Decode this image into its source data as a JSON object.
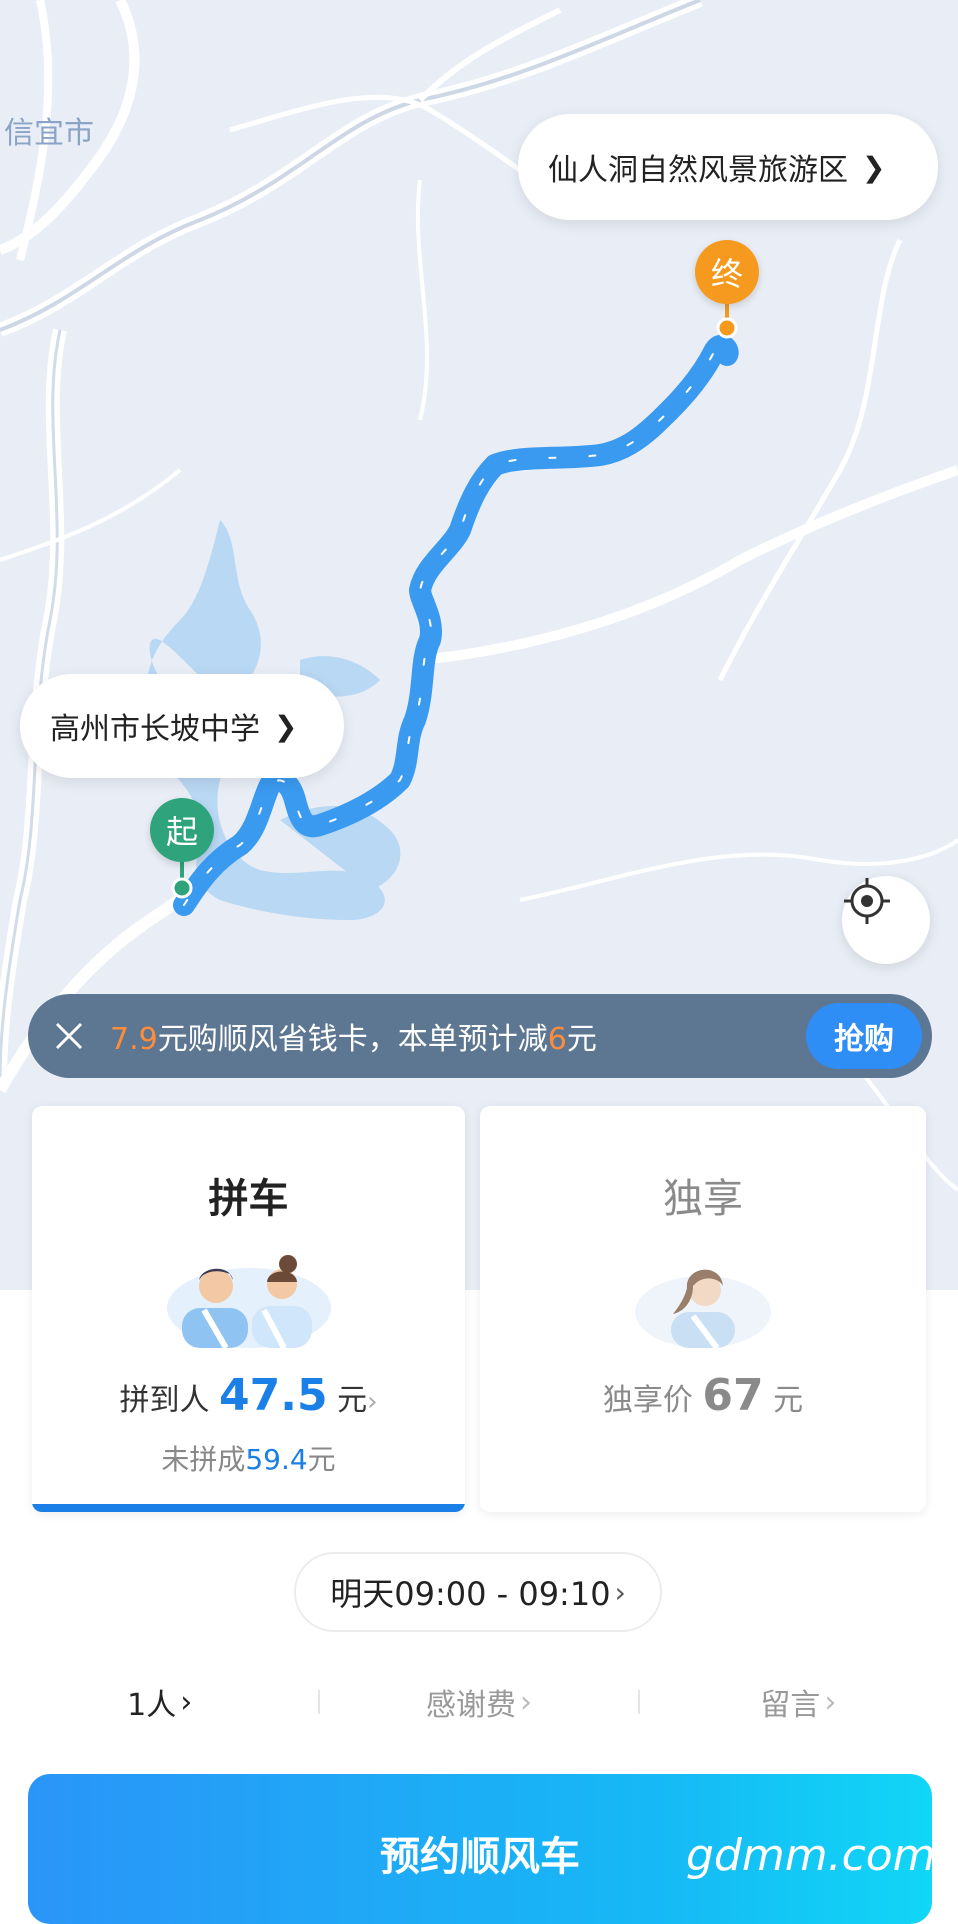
{
  "map": {
    "city_label": "信宜市",
    "destination_label": "仙人洞自然风景旅游区",
    "origin_label": "高州市长坡中学",
    "start_pin": "起",
    "end_pin": "终",
    "locate_icon": "locate-target-icon",
    "colors": {
      "route": "#3a9af0",
      "start": "#2fa37b",
      "end": "#f59a1e"
    }
  },
  "promo": {
    "price": "7.9",
    "text_a": "元购顺风省钱卡，本单预计减",
    "discount": "6",
    "text_b": "元",
    "button": "抢购",
    "close_icon": "close-icon"
  },
  "cards": {
    "carpool": {
      "title": "拼车",
      "price_prefix": "拼到人",
      "price": "47.5",
      "unit": "元",
      "sub_prefix": "未拼成",
      "sub_price": "59.4",
      "sub_unit": "元"
    },
    "exclusive": {
      "title": "独享",
      "price_prefix": "独享价",
      "price": "67",
      "unit": "元"
    }
  },
  "time": {
    "label": "明天09:00 - 09:10"
  },
  "options": [
    {
      "label": "1人"
    },
    {
      "label": "感谢费"
    },
    {
      "label": "留言"
    }
  ],
  "cta": {
    "label": "预约顺风车"
  },
  "watermark": "gdmm.com"
}
